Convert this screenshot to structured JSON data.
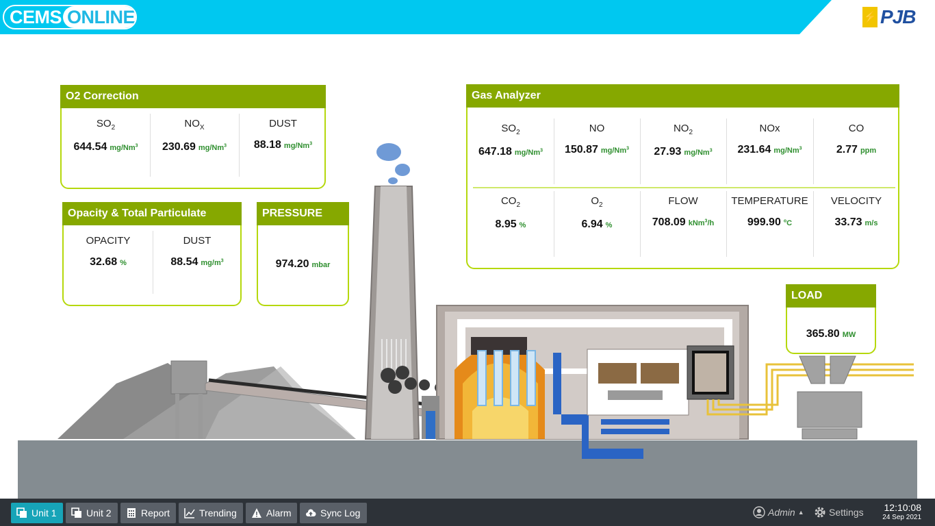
{
  "app": {
    "logo_part1": "CEMS",
    "logo_part2": "ONLINE",
    "brand_mark": "PJB",
    "accent_color": "#00c8f0",
    "panel_header_color": "#86a800",
    "panel_border_color": "#b5d80c"
  },
  "o2_correction": {
    "title": "O2 Correction",
    "items": [
      {
        "label": "SO",
        "sub": "2",
        "value": "644.54",
        "unit": "mg/Nm",
        "unit_sup": "3"
      },
      {
        "label": "NO",
        "sub": "X",
        "value": "230.69",
        "unit": "mg/Nm",
        "unit_sup": "3"
      },
      {
        "label": "DUST",
        "sub": "",
        "value": "88.18",
        "unit": "mg/Nm",
        "unit_sup": "3"
      }
    ]
  },
  "opacity": {
    "title": "Opacity & Total Particulate",
    "items": [
      {
        "label": "OPACITY",
        "sub": "",
        "value": "32.68",
        "unit": "%",
        "unit_sup": ""
      },
      {
        "label": "DUST",
        "sub": "",
        "value": "88.54",
        "unit": "mg/m",
        "unit_sup": "3"
      }
    ]
  },
  "pressure": {
    "title": "PRESSURE",
    "value": "974.20",
    "unit": "mbar"
  },
  "gas_analyzer": {
    "title": "Gas Analyzer",
    "row1": [
      {
        "label": "SO",
        "sub": "2",
        "value": "647.18",
        "unit": "mg/Nm",
        "unit_sup": "3"
      },
      {
        "label": "NO",
        "sub": "",
        "value": "150.87",
        "unit": "mg/Nm",
        "unit_sup": "3"
      },
      {
        "label": "NO",
        "sub": "2",
        "value": "27.93",
        "unit": "mg/Nm",
        "unit_sup": "3"
      },
      {
        "label": "NOx",
        "sub": "",
        "value": "231.64",
        "unit": "mg/Nm",
        "unit_sup": "3"
      },
      {
        "label": "CO",
        "sub": "",
        "value": "2.77",
        "unit": "ppm",
        "unit_sup": ""
      }
    ],
    "row2": [
      {
        "label": "CO",
        "sub": "2",
        "value": "8.95",
        "unit": "%",
        "unit_sup": ""
      },
      {
        "label": "O",
        "sub": "2",
        "value": "6.94",
        "unit": "%",
        "unit_sup": ""
      },
      {
        "label": "FLOW",
        "sub": "",
        "value": "708.09",
        "unit": "kNm",
        "unit_sup": "3",
        "unit_tail": "/h"
      },
      {
        "label": "TEMPERATURE",
        "sub": "",
        "value": "999.90",
        "unit": "",
        "unit_sup": "o",
        "unit_tail": "C"
      },
      {
        "label": "VELOCITY",
        "sub": "",
        "value": "33.73",
        "unit": "m/s",
        "unit_sup": ""
      }
    ]
  },
  "load": {
    "title": "LOAD",
    "value": "365.80",
    "unit": "MW"
  },
  "taskbar": {
    "buttons": [
      {
        "label": "Unit 1",
        "icon": "copy-icon",
        "active": true
      },
      {
        "label": "Unit 2",
        "icon": "copy-icon",
        "active": false
      },
      {
        "label": "Report",
        "icon": "calculator-icon",
        "active": false
      },
      {
        "label": "Trending",
        "icon": "line-chart-icon",
        "active": false
      },
      {
        "label": "Alarm",
        "icon": "warning-icon",
        "active": false
      },
      {
        "label": "Sync Log",
        "icon": "cloud-upload-icon",
        "active": false
      }
    ],
    "user": "Admin",
    "settings": "Settings",
    "time": "12:10:08",
    "date": "24 Sep 2021"
  }
}
